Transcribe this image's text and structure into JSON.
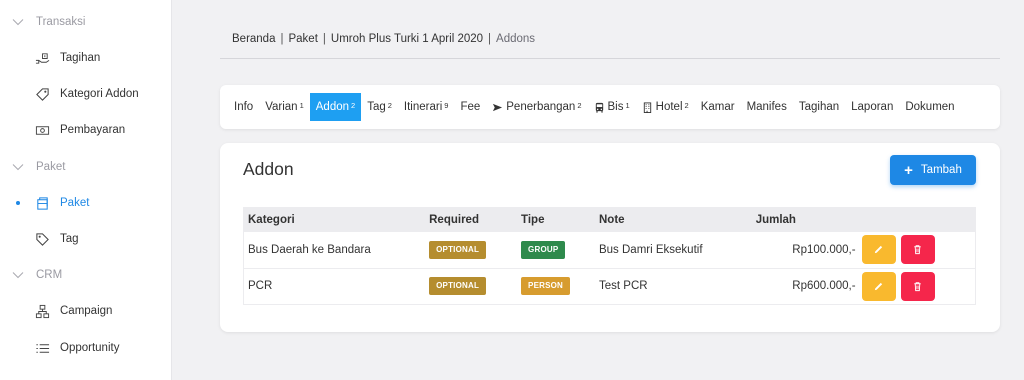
{
  "sidebar": {
    "sections": [
      {
        "label": "Transaksi"
      },
      {
        "label": "Paket"
      },
      {
        "label": "CRM"
      }
    ],
    "items": [
      {
        "label": "Tagihan",
        "icon": "hand-money-icon"
      },
      {
        "label": "Kategori Addon",
        "icon": "tag-icon"
      },
      {
        "label": "Pembayaran",
        "icon": "cash-icon"
      },
      {
        "label": "Paket",
        "icon": "package-icon",
        "active": true
      },
      {
        "label": "Tag",
        "icon": "tag-icon"
      },
      {
        "label": "Campaign",
        "icon": "sitemap-icon"
      },
      {
        "label": "Opportunity",
        "icon": "list-icon"
      }
    ]
  },
  "breadcrumb": [
    "Beranda",
    "Paket",
    "Umroh Plus Turki 1 April 2020",
    "Addons"
  ],
  "tabs": [
    {
      "label": "Info",
      "count": ""
    },
    {
      "label": "Varian",
      "count": "1"
    },
    {
      "label": "Addon",
      "count": "2",
      "active": true
    },
    {
      "label": "Tag",
      "count": "2"
    },
    {
      "label": "Itinerari",
      "count": "9"
    },
    {
      "label": "Fee",
      "count": ""
    },
    {
      "label": "Penerbangan",
      "count": "2",
      "icon": "plane-icon"
    },
    {
      "label": "Bis",
      "count": "1",
      "icon": "bus-icon"
    },
    {
      "label": "Hotel",
      "count": "2",
      "icon": "building-icon"
    },
    {
      "label": "Kamar",
      "count": ""
    },
    {
      "label": "Manifes",
      "count": ""
    },
    {
      "label": "Tagihan",
      "count": ""
    },
    {
      "label": "Laporan",
      "count": ""
    },
    {
      "label": "Dokumen",
      "count": ""
    }
  ],
  "addon": {
    "title": "Addon",
    "add_button": "Tambah",
    "columns": [
      "Kategori",
      "Required",
      "Tipe",
      "Note",
      "Jumlah"
    ],
    "rows": [
      {
        "kategori": "Bus Daerah ke Bandara",
        "required": "OPTIONAL",
        "tipe": "GROUP",
        "note": "Bus Damri Eksekutif",
        "jumlah": "Rp100.000,-"
      },
      {
        "kategori": "PCR",
        "required": "OPTIONAL",
        "tipe": "PERSON",
        "note": "Test PCR",
        "jumlah": "Rp600.000,-"
      }
    ]
  },
  "colors": {
    "primary": "#1e88e5",
    "tab_active": "#1e9ff2",
    "optional": "#b58d2f",
    "group": "#2e8a4c",
    "person": "#d79c2f",
    "edit": "#f9b92e",
    "delete": "#f5264b"
  }
}
